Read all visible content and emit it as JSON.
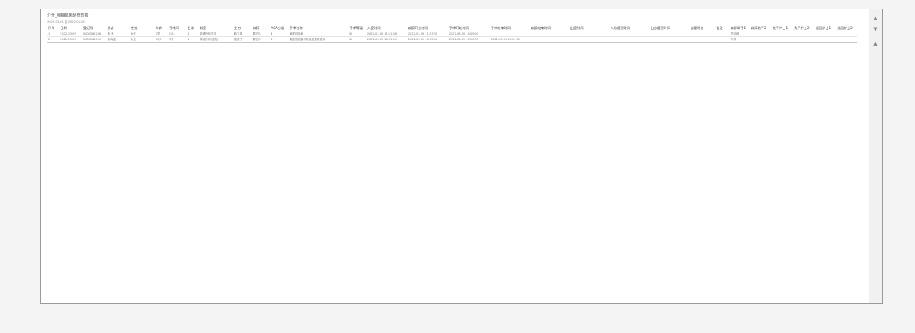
{
  "report": {
    "title": "介仕_我静能麻醉管理报",
    "date_range": "2022-03-01 至 2022-03-09"
  },
  "table": {
    "columns": [
      "序号",
      "日期",
      "登记号",
      "患者",
      "性别",
      "年龄",
      "手术间",
      "台次",
      "科室",
      "主刀",
      "麻醉",
      "ASA分级",
      "手术名称",
      "手术等级",
      "入室时间",
      "麻醉开始时间",
      "手术开始时间",
      "手术结束时间",
      "麻醉结束时间",
      "出室时间",
      "入苏醒室时间",
      "出苏醒室时间",
      "苏醒时长",
      "备注",
      "麻醉助手1",
      "麻醉助手2",
      "洗手护士1",
      "洗手护士2",
      "巡回护士1",
      "巡回护士2"
    ],
    "rows": [
      [
        "1",
        "2022-03-09",
        "0000081238",
        "黄 系",
        "女性",
        "7岁",
        "OR-1",
        "1",
        "普通外科门诊",
        "韩玉英",
        "秦宏伟",
        "Ⅱ",
        "阑尾切除术",
        "Ⅲ",
        "2022-03-09 11:11:06",
        "2022-03-09 11:37:30",
        "2022-03-09 14:09:01",
        "",
        "",
        "",
        "",
        "",
        "",
        "",
        "张宇涵",
        "",
        "",
        "",
        "",
        ""
      ],
      [
        "2",
        "2022-03-09",
        "0000081590",
        "黄海宝",
        "女性",
        "50岁",
        "3号",
        "1",
        "神经外科(住院)",
        "程俊宁",
        "秦宏伟",
        "1",
        "腹腔镜胆囊切除及胆道探查术",
        "Ⅲ",
        "2022-03-09 16:01:49",
        "2022-03-09 16:03:40",
        "2022-03-09 16:10:33",
        "2022-03-09 16:11:05",
        "",
        "",
        "",
        "",
        "",
        "",
        "李伟",
        "",
        "",
        "",
        "",
        ""
      ]
    ]
  },
  "scrollbar": {
    "up_icon": "▲",
    "down_icon": "▼",
    "collapse_icon": "▲"
  }
}
